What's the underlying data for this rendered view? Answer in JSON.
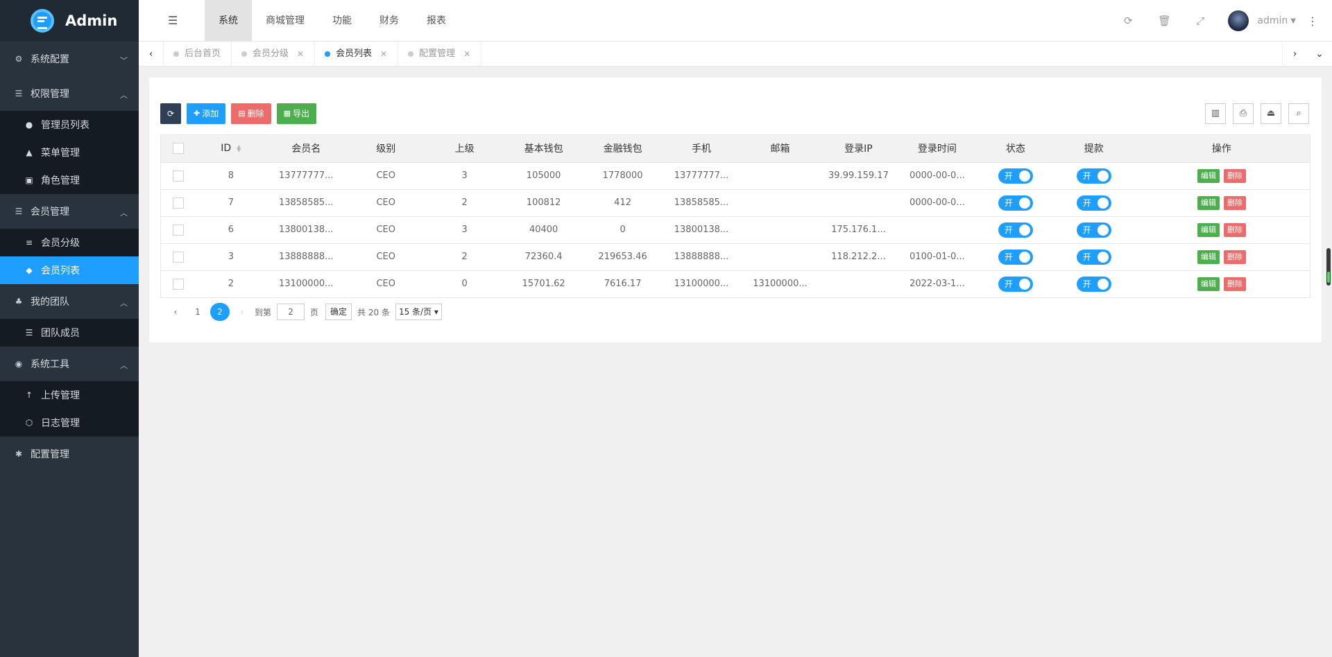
{
  "app": {
    "title": "Admin"
  },
  "header": {
    "nav": [
      "系统",
      "商城管理",
      "功能",
      "财务",
      "报表"
    ],
    "active_nav": 0,
    "user": "admin"
  },
  "sidebar": {
    "groups": [
      {
        "label": "系统配置",
        "icon": "gears-icon",
        "expanded": false,
        "items": []
      },
      {
        "label": "权限管理",
        "icon": "list-icon",
        "expanded": true,
        "items": [
          {
            "label": "管理员列表",
            "icon": "user-icon"
          },
          {
            "label": "菜单管理",
            "icon": "tree-icon"
          },
          {
            "label": "角色管理",
            "icon": "id-card-icon"
          }
        ]
      },
      {
        "label": "会员管理",
        "icon": "list-icon",
        "expanded": true,
        "items": [
          {
            "label": "会员分级",
            "icon": "bars-icon"
          },
          {
            "label": "会员列表",
            "icon": "graduation-cap-icon",
            "active": true
          }
        ]
      },
      {
        "label": "我的团队",
        "icon": "sitemap-icon",
        "expanded": true,
        "items": [
          {
            "label": "团队成员",
            "icon": "list-icon"
          }
        ]
      },
      {
        "label": "系统工具",
        "icon": "compass-icon",
        "expanded": true,
        "items": [
          {
            "label": "上传管理",
            "icon": "arrow-up-icon"
          },
          {
            "label": "日志管理",
            "icon": "hexagon-icon"
          }
        ]
      },
      {
        "label": "配置管理",
        "icon": "asterisk-icon",
        "expanded": false,
        "items": []
      }
    ]
  },
  "tabs": [
    {
      "label": "后台首页",
      "closable": false
    },
    {
      "label": "会员分级",
      "closable": true
    },
    {
      "label": "会员列表",
      "closable": true,
      "active": true
    },
    {
      "label": "配置管理",
      "closable": true
    }
  ],
  "toolbar": {
    "add": "添加",
    "delete": "删除",
    "export": "导出"
  },
  "table": {
    "columns": [
      "ID",
      "会员名",
      "级别",
      "上级",
      "基本钱包",
      "金融钱包",
      "手机",
      "邮箱",
      "登录IP",
      "登录时间",
      "状态",
      "提款",
      "操作"
    ],
    "rows": [
      {
        "id": "8",
        "name": "13777777...",
        "level": "CEO",
        "parent": "3",
        "wallet": "105000",
        "fin_wallet": "1778000",
        "phone": "13777777...",
        "email": "",
        "ip": "39.99.159.17",
        "login_time": "0000-00-0...",
        "status": "开",
        "withdraw": "开"
      },
      {
        "id": "7",
        "name": "13858585...",
        "level": "CEO",
        "parent": "2",
        "wallet": "100812",
        "fin_wallet": "412",
        "phone": "13858585...",
        "email": "",
        "ip": "",
        "login_time": "0000-00-0...",
        "status": "开",
        "withdraw": "开"
      },
      {
        "id": "6",
        "name": "13800138...",
        "level": "CEO",
        "parent": "3",
        "wallet": "40400",
        "fin_wallet": "0",
        "phone": "13800138...",
        "email": "",
        "ip": "175.176.1...",
        "login_time": "",
        "status": "开",
        "withdraw": "开"
      },
      {
        "id": "3",
        "name": "13888888...",
        "level": "CEO",
        "parent": "2",
        "wallet": "72360.4",
        "fin_wallet": "219653.46",
        "phone": "13888888...",
        "email": "",
        "ip": "118.212.2...",
        "login_time": "0100-01-0...",
        "status": "开",
        "withdraw": "开"
      },
      {
        "id": "2",
        "name": "13100000...",
        "level": "CEO",
        "parent": "0",
        "wallet": "15701.62",
        "fin_wallet": "7616.17",
        "phone": "13100000...",
        "email": "13100000...",
        "ip": "",
        "login_time": "2022-03-1...",
        "status": "开",
        "withdraw": "开"
      }
    ],
    "edit_label": "编辑",
    "delete_label": "删除"
  },
  "pager": {
    "pages": [
      "1",
      "2"
    ],
    "current": "2",
    "goto_label": "到第",
    "goto_value": "2",
    "page_unit": "页",
    "confirm": "确定",
    "total": "共 20 条",
    "page_size": "15 条/页"
  }
}
